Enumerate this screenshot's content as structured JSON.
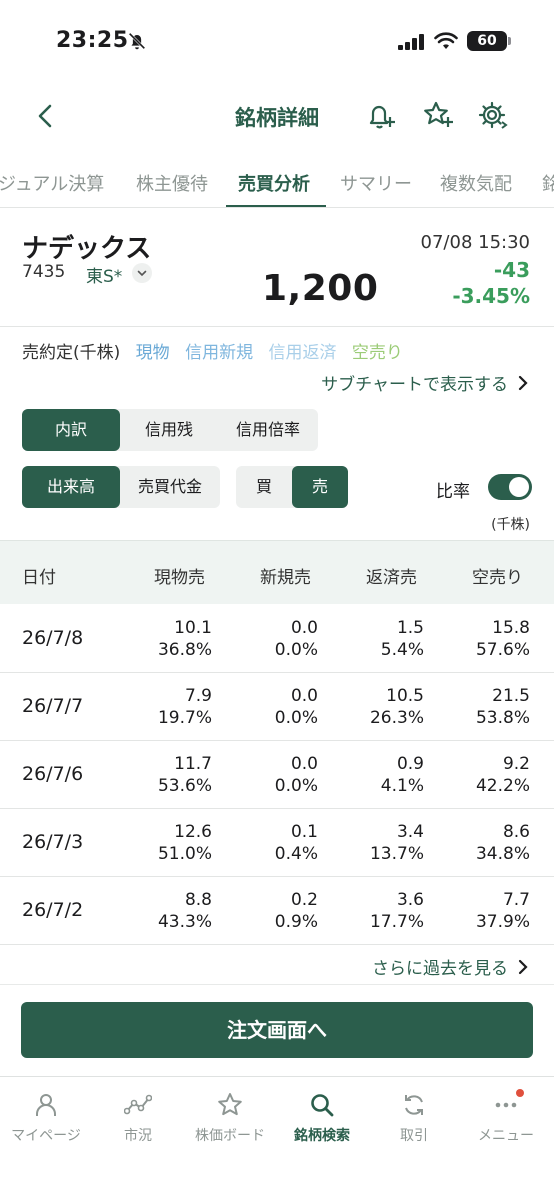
{
  "status_bar": {
    "time": "23:25",
    "battery": "60"
  },
  "header": {
    "title": "銘柄詳細"
  },
  "tabs": [
    {
      "label": "ジュアル決算"
    },
    {
      "label": "株主優待"
    },
    {
      "label": "売買分析",
      "active": true
    },
    {
      "label": "サマリー"
    },
    {
      "label": "複数気配"
    },
    {
      "label": "銘"
    }
  ],
  "stock": {
    "name": "ナデックス",
    "code": "7435",
    "market": "東S*",
    "price": "1,200",
    "datetime": "07/08 15:30",
    "change": "-43",
    "change_pct": "-3.45%"
  },
  "legend": {
    "title": "売約定(千株)",
    "genbutsu": "現物",
    "shinyo_shinki": "信用新規",
    "shinyo_hensai": "信用返済",
    "karauri": "空売り"
  },
  "subchart_link": "サブチャートで表示する",
  "segments": {
    "breakdown": [
      "内訳",
      "信用残",
      "信用倍率"
    ],
    "volume": [
      "出来高",
      "売買代金"
    ],
    "side": [
      "買",
      "売"
    ]
  },
  "ratio_label": "比率",
  "ratio_on": true,
  "unit": "(千株)",
  "table": {
    "headers": [
      "日付",
      "現物売",
      "新規売",
      "返済売",
      "空売り"
    ],
    "rows": [
      {
        "date": "26/7/8",
        "cells": [
          [
            "10.1",
            "36.8%"
          ],
          [
            "0.0",
            "0.0%"
          ],
          [
            "1.5",
            "5.4%"
          ],
          [
            "15.8",
            "57.6%"
          ]
        ]
      },
      {
        "date": "26/7/7",
        "cells": [
          [
            "7.9",
            "19.7%"
          ],
          [
            "0.0",
            "0.0%"
          ],
          [
            "10.5",
            "26.3%"
          ],
          [
            "21.5",
            "53.8%"
          ]
        ]
      },
      {
        "date": "26/7/6",
        "cells": [
          [
            "11.7",
            "53.6%"
          ],
          [
            "0.0",
            "0.0%"
          ],
          [
            "0.9",
            "4.1%"
          ],
          [
            "9.2",
            "42.2%"
          ]
        ]
      },
      {
        "date": "26/7/3",
        "cells": [
          [
            "12.6",
            "51.0%"
          ],
          [
            "0.1",
            "0.4%"
          ],
          [
            "3.4",
            "13.7%"
          ],
          [
            "8.6",
            "34.8%"
          ]
        ]
      },
      {
        "date": "26/7/2",
        "cells": [
          [
            "8.8",
            "43.3%"
          ],
          [
            "0.2",
            "0.9%"
          ],
          [
            "3.6",
            "17.7%"
          ],
          [
            "7.7",
            "37.9%"
          ]
        ]
      }
    ]
  },
  "more_link": "さらに過去を見る",
  "order_button": "注文画面へ",
  "bottom_nav": [
    {
      "label": "マイページ",
      "icon": "person-icon"
    },
    {
      "label": "市況",
      "icon": "market-chart-icon"
    },
    {
      "label": "株価ボード",
      "icon": "star-icon"
    },
    {
      "label": "銘柄検索",
      "icon": "search-icon",
      "active": true
    },
    {
      "label": "取引",
      "icon": "refresh-icon"
    },
    {
      "label": "メニュー",
      "icon": "more-icon",
      "badge": true
    }
  ],
  "colors": {
    "primary": "#2b5e4c",
    "down": "#3a9d5c",
    "genbutsu": "#6aa9d6",
    "shinyo_shinki": "#7fb6de",
    "shinyo_hensai": "#a9cfe9",
    "karauri": "#9ccc78"
  }
}
